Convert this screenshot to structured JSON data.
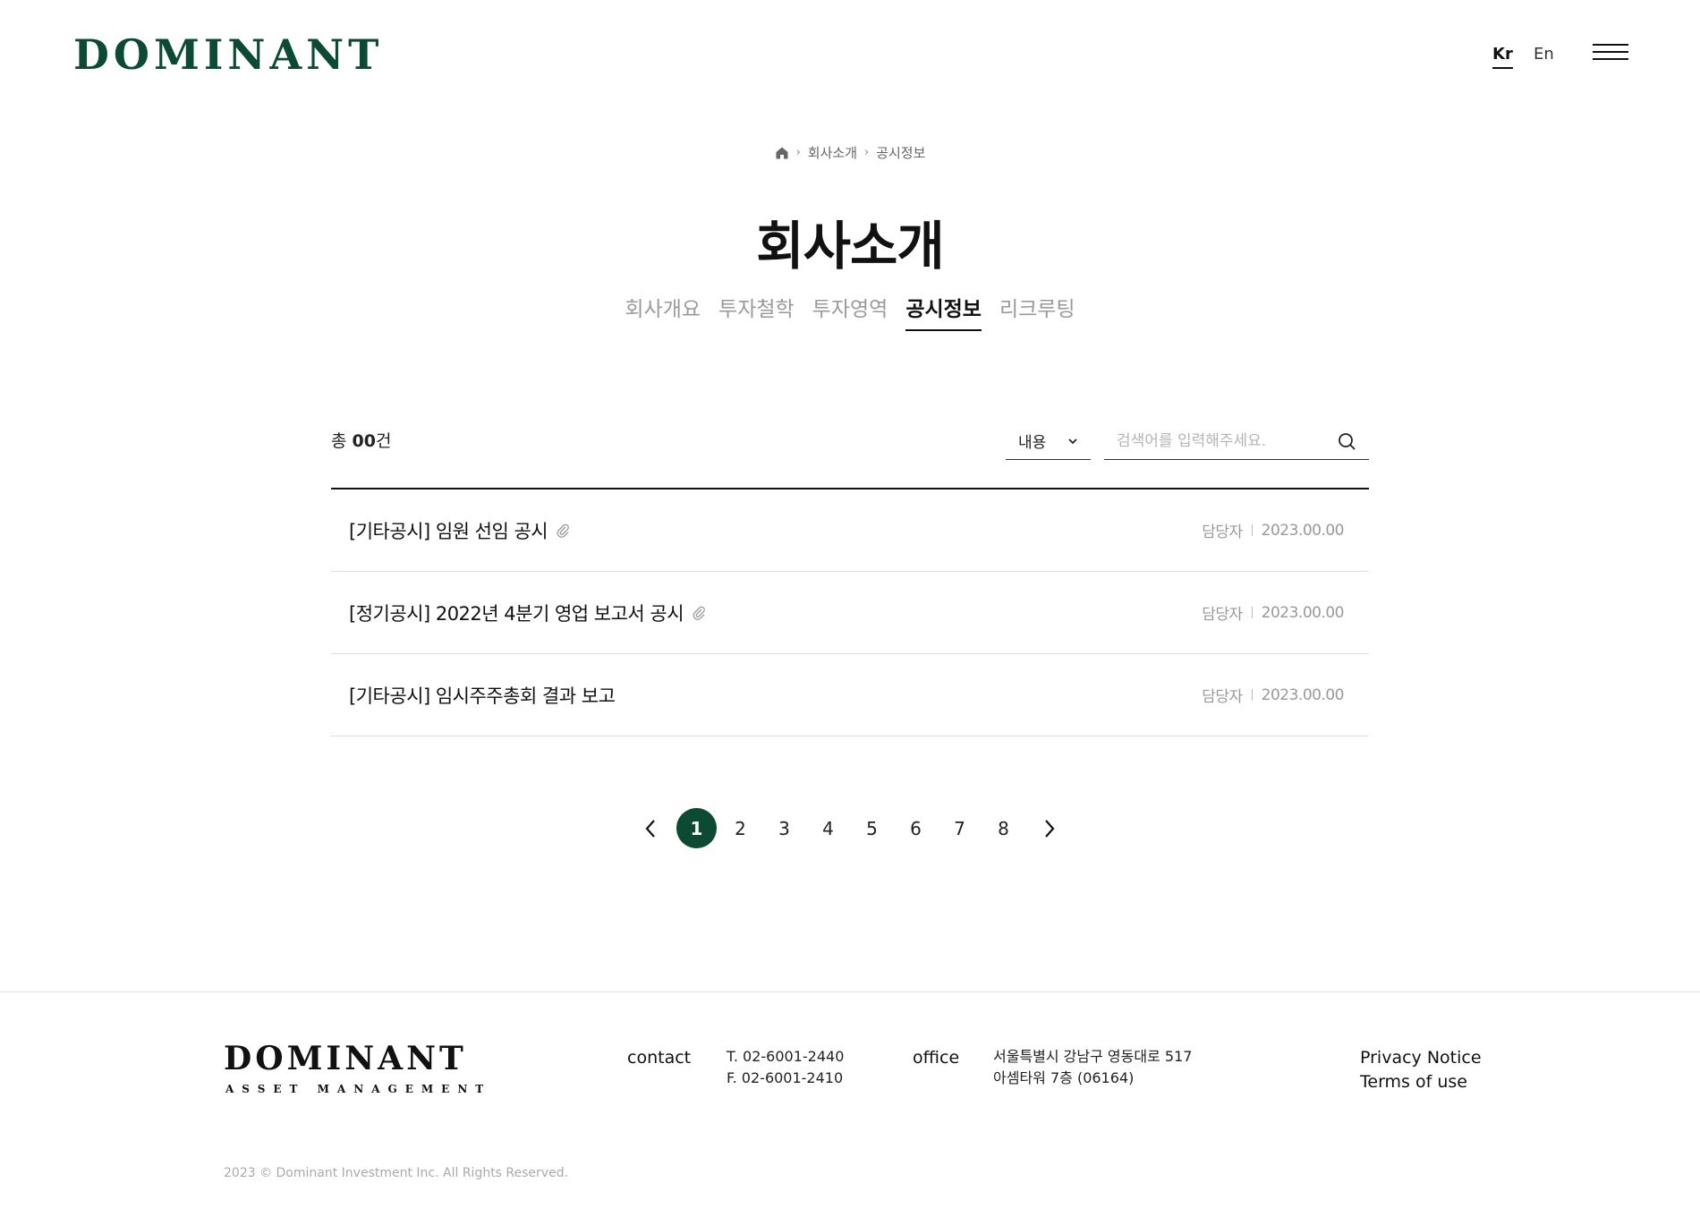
{
  "header": {
    "logo": "DOMINANT",
    "lang_kr": "Kr",
    "lang_en": "En"
  },
  "breadcrumb": {
    "level1": "회사소개",
    "level2": "공시정보"
  },
  "page_title": "회사소개",
  "subnav": [
    "회사개요",
    "투자철학",
    "투자영역",
    "공시정보",
    "리크루팅"
  ],
  "list_header": {
    "count_prefix": "총 ",
    "count_value": "00",
    "count_suffix": "건",
    "filter_label": "내용",
    "search_placeholder": "검색어를 입력해주세요."
  },
  "rows": [
    {
      "title": "[기타공시] 임원 선임 공시",
      "author": "담당자",
      "date": "2023.00.00",
      "attachment": true
    },
    {
      "title": "[정기공시] 2022년 4분기 영업 보고서 공시",
      "author": "담당자",
      "date": "2023.00.00",
      "attachment": true
    },
    {
      "title": "[기타공시] 임시주주총회 결과 보고",
      "author": "담당자",
      "date": "2023.00.00",
      "attachment": false
    }
  ],
  "pagination": {
    "pages": [
      "1",
      "2",
      "3",
      "4",
      "5",
      "6",
      "7",
      "8"
    ],
    "current": "1"
  },
  "footer": {
    "logo": "DOMINANT",
    "logo_sub": "ASSET MANAGEMENT",
    "contact_label": "contact",
    "tel": "T. 02-6001-2440",
    "fax": "F. 02-6001-2410",
    "office_label": "office",
    "address_line1": "서울특별시 강남구 영동대로 517",
    "address_line2": "아셈타워 7층 (06164)",
    "privacy": "Privacy Notice",
    "terms": "Terms of use",
    "copyright": "2023 © Dominant Investment Inc. All Rights Reserved."
  },
  "colors": {
    "brand": "#0c4a33",
    "muted": "#9a9a9a"
  }
}
